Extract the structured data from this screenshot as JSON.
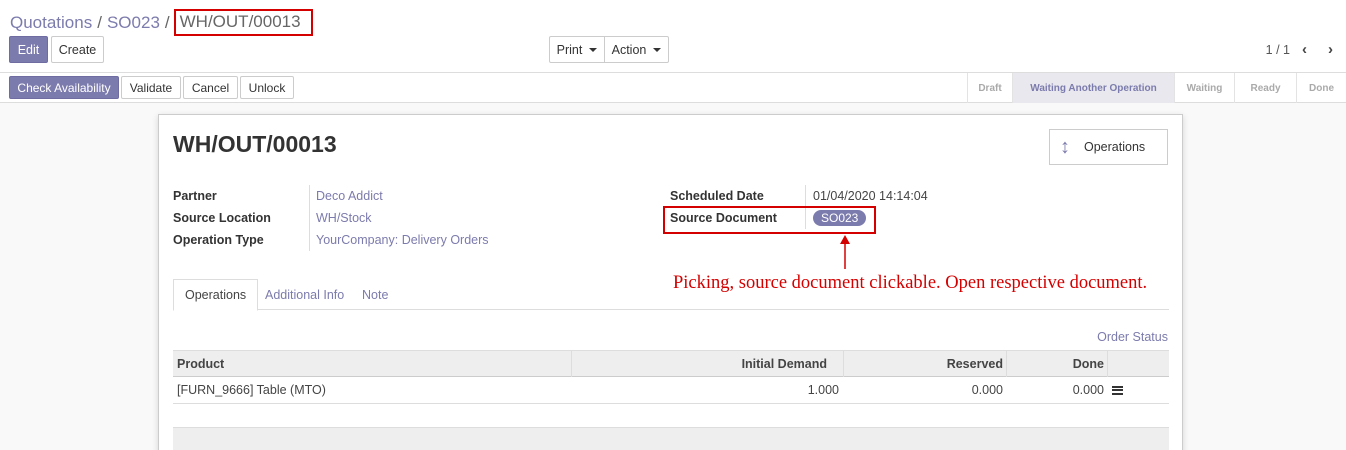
{
  "breadcrumb": {
    "items": [
      "Quotations",
      "SO023"
    ],
    "current": "WH/OUT/00013"
  },
  "toolbar": {
    "edit_label": "Edit",
    "create_label": "Create",
    "print_label": "Print",
    "action_label": "Action",
    "pager": "1 / 1"
  },
  "actions": {
    "check_availability": "Check Availability",
    "validate": "Validate",
    "cancel": "Cancel",
    "unlock": "Unlock"
  },
  "status_bar": {
    "stages": [
      "Draft",
      "Waiting Another Operation",
      "Waiting",
      "Ready",
      "Done"
    ],
    "active_stage": "Waiting Another Operation"
  },
  "record": {
    "title": "WH/OUT/00013",
    "operations_button": "Operations",
    "fields": {
      "partner_label": "Partner",
      "partner_value": "Deco Addict",
      "source_location_label": "Source Location",
      "source_location_value": "WH/Stock",
      "operation_type_label": "Operation Type",
      "operation_type_value": "YourCompany: Delivery Orders",
      "scheduled_date_label": "Scheduled Date",
      "scheduled_date_value": "01/04/2020 14:14:04",
      "source_document_label": "Source Document",
      "source_document_value": "SO023"
    }
  },
  "annotation": "Picking, source document clickable. Open respective document.",
  "tabs": [
    "Operations",
    "Additional Info",
    "Note"
  ],
  "order_status_link": "Order Status",
  "table": {
    "columns": [
      "Product",
      "Initial Demand",
      "Reserved",
      "Done"
    ],
    "rows": [
      {
        "product": "[FURN_9666] Table (MTO)",
        "initial_demand": "1.000",
        "reserved": "0.000",
        "done": "0.000"
      }
    ]
  },
  "colors": {
    "primary": "#7c7bad",
    "annotation": "#d40000"
  },
  "icons": {
    "operations": "vertical-arrows-icon",
    "detail": "list-icon",
    "prev": "chevron-left-icon",
    "next": "chevron-right-icon"
  }
}
